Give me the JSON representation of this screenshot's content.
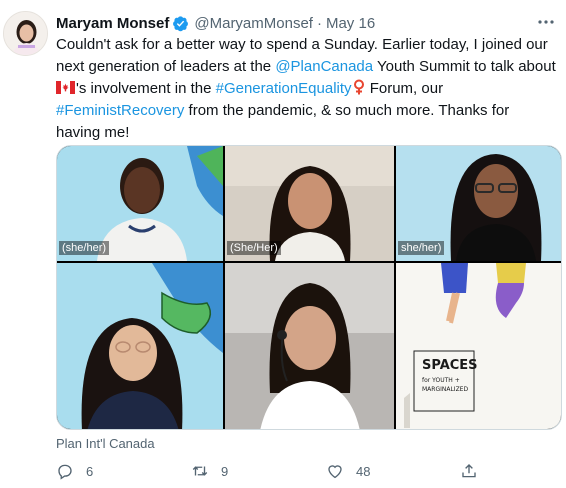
{
  "tweet": {
    "author_name": "Maryam Monsef",
    "handle": "@MaryamMonsef",
    "separator": "·",
    "date": "May 16",
    "text": {
      "p1": "Couldn't ask for a better way to spend a Sunday. Earlier today, I joined our next generation of leaders at the ",
      "mention": "@PlanCanada",
      "p2": " Youth Summit to talk about ",
      "p3": "'s involvement in the ",
      "hashtag1": "#GenerationEquality",
      "p4": " Forum, our ",
      "hashtag2": "#FeministRecovery",
      "p5": " from the pandemic, & so much more. Thanks for having me!"
    },
    "media_labels": {
      "tile1": "(she/her)",
      "tile2": "(She/Her)",
      "tile3": "she/her)"
    },
    "poster_text": {
      "line1": "SPACES",
      "line2": "for YOUTH +",
      "line3": "MARGINALIZED"
    },
    "source": "Plan Int'l Canada",
    "counts": {
      "replies": "6",
      "retweets": "9",
      "likes": "48"
    }
  },
  "colors": {
    "link": "#1b95e0",
    "secondary": "#536471",
    "verified": "#1d9bf0"
  },
  "icons": [
    "avatar",
    "verified-badge-icon",
    "more-icon",
    "canada-flag-icon",
    "venus-symbol-icon",
    "reply-icon",
    "retweet-icon",
    "like-icon",
    "share-icon"
  ]
}
